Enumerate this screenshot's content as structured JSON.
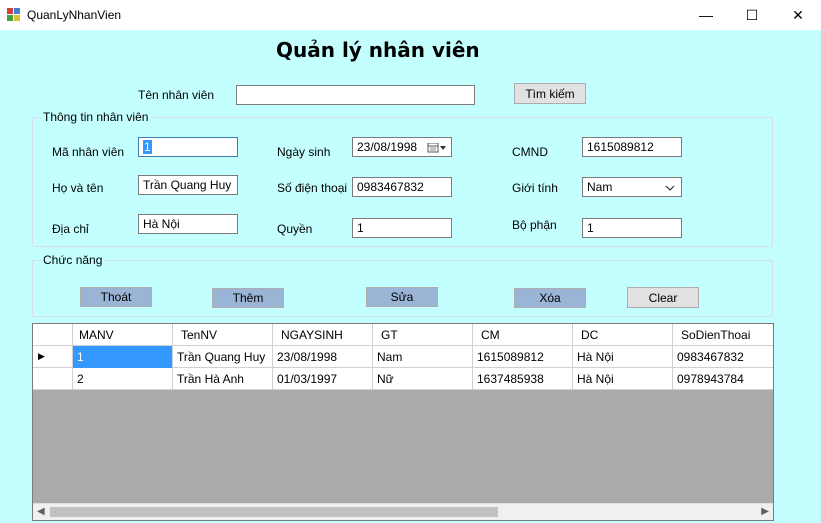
{
  "window": {
    "title": "QuanLyNhanVien",
    "minimize_glyph": "—",
    "maximize_glyph": "☐",
    "close_glyph": "✕"
  },
  "form_title": "Quản lý nhân viên",
  "search": {
    "label": "Tên nhân viên",
    "value": "",
    "button": "Tìm kiếm"
  },
  "info": {
    "group_title": "Thông tin nhân viên",
    "manv_label": "Mã nhân viên",
    "manv_value": "1",
    "hoten_label": "Họ và tên",
    "hoten_value": "Trần Quang Huy",
    "diachi_label": "Địa chỉ",
    "diachi_value": "Hà Nội",
    "ngaysinh_label": "Ngày sinh",
    "ngaysinh_value": "23/08/1998",
    "sdt_label": "Số điện thoại",
    "sdt_value": "0983467832",
    "quyen_label": "Quyền",
    "quyen_value": "1",
    "cmnd_label": "CMND",
    "cmnd_value": "1615089812",
    "gioitinh_label": "Giới tính",
    "gioitinh_value": "Nam",
    "bophan_label": "Bộ phận",
    "bophan_value": "1"
  },
  "functions": {
    "group_title": "Chức năng",
    "exit": "Thoát",
    "add": "Thêm",
    "edit": "Sửa",
    "delete": "Xóa",
    "clear": "Clear"
  },
  "grid": {
    "columns": [
      "MANV",
      "TenNV",
      "NGAYSINH",
      "GT",
      "CM",
      "DC",
      "SoDienThoai"
    ],
    "rows": [
      [
        "1",
        "Trần Quang Huy",
        "23/08/1998",
        "Nam",
        "1615089812",
        "Hà Nội",
        "0983467832"
      ],
      [
        "2",
        "Trần Hà Anh",
        "01/03/1997",
        "Nữ",
        "1637485938",
        "Hà Nội",
        "0978943784"
      ]
    ],
    "current_row_glyph": "▶"
  },
  "colors": {
    "background": "#c4ffff",
    "button_blue": "#9ab4d5",
    "selection": "#3399ff"
  }
}
